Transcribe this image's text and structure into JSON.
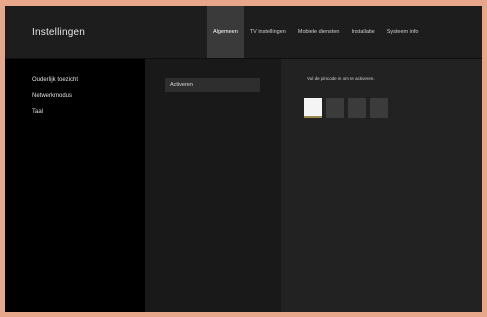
{
  "header": {
    "title": "Instellingen",
    "tabs": [
      {
        "label": "Algemeen",
        "active": true
      },
      {
        "label": "TV instellingen",
        "active": false
      },
      {
        "label": "Mobiele diensten",
        "active": false
      },
      {
        "label": "Installatie",
        "active": false
      },
      {
        "label": "Systeem info",
        "active": false
      }
    ]
  },
  "sidebar": {
    "items": [
      {
        "label": "Ouderlijk toezicht"
      },
      {
        "label": "Netwerkmodus"
      },
      {
        "label": "Taal"
      }
    ]
  },
  "middle": {
    "action_label": "Activeren"
  },
  "pin_panel": {
    "instruction": "Vul de pincode in om te activeren.",
    "digits": [
      "",
      "",
      "",
      ""
    ],
    "active_index": 0
  },
  "colors": {
    "frame_border": "#e7a78a",
    "active_tab_bg": "#3a3a3a",
    "active_pin_bg": "#f4f4f4",
    "active_pin_underline": "#9b8a4e"
  }
}
